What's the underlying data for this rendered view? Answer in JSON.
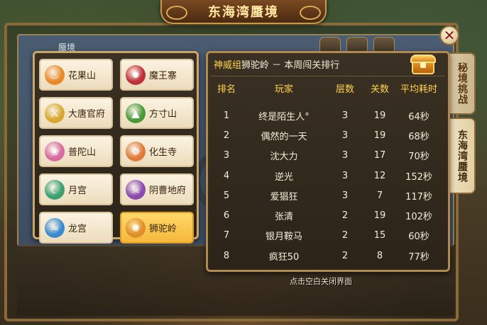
{
  "banner": {
    "title": "东海湾蜃境"
  },
  "panel": {
    "crumb": "蜃境"
  },
  "side_tabs": [
    {
      "label": "秘境挑战"
    },
    {
      "label": "东海湾蜃境"
    }
  ],
  "close": {
    "icon": "close-icon",
    "glyph": "✕"
  },
  "sects": [
    {
      "label": "花果山",
      "icon": "flame-icon",
      "color": "#e8892a",
      "glyph": "♨",
      "selected": false
    },
    {
      "label": "魔王寨",
      "icon": "demon-icon",
      "color": "#c0303a",
      "glyph": "✹",
      "selected": false
    },
    {
      "label": "大唐官府",
      "icon": "sword-icon",
      "color": "#d8a830",
      "glyph": "⚔",
      "selected": false
    },
    {
      "label": "方寸山",
      "icon": "mountain-icon",
      "color": "#4a9a3a",
      "glyph": "▲",
      "selected": false
    },
    {
      "label": "普陀山",
      "icon": "lotus-icon",
      "color": "#d86aa0",
      "glyph": "❀",
      "selected": false
    },
    {
      "label": "化生寺",
      "icon": "temple-icon",
      "color": "#e07a3a",
      "glyph": "☸",
      "selected": false
    },
    {
      "label": "月宫",
      "icon": "moon-icon",
      "color": "#3aa070",
      "glyph": "☾",
      "selected": false
    },
    {
      "label": "阴曹地府",
      "icon": "skull-icon",
      "color": "#8a4ab0",
      "glyph": "☠",
      "selected": false
    },
    {
      "label": "龙宫",
      "icon": "dragon-icon",
      "color": "#3a8ad0",
      "glyph": "≈",
      "selected": false
    },
    {
      "label": "狮驼岭",
      "icon": "lion-icon",
      "color": "#e0902a",
      "glyph": "✺",
      "selected": true
    }
  ],
  "ranking": {
    "group": "神威组",
    "title_rest": "狮驼岭 － 本周闯关排行",
    "chest_icon": "treasure-chest-icon",
    "columns": [
      "排名",
      "玩家",
      "层数",
      "关数",
      "平均耗时"
    ],
    "rows": [
      {
        "rank": "1",
        "player": "终是陌生人°",
        "layers": "3",
        "levels": "19",
        "time": "64秒"
      },
      {
        "rank": "2",
        "player": "偶然的一天",
        "layers": "3",
        "levels": "19",
        "time": "68秒"
      },
      {
        "rank": "3",
        "player": "沈大力",
        "layers": "3",
        "levels": "17",
        "time": "70秒"
      },
      {
        "rank": "4",
        "player": "逆光",
        "layers": "3",
        "levels": "12",
        "time": "152秒"
      },
      {
        "rank": "5",
        "player": "爱猖狂",
        "layers": "3",
        "levels": "7",
        "time": "117秒"
      },
      {
        "rank": "6",
        "player": "张清",
        "layers": "2",
        "levels": "19",
        "time": "102秒"
      },
      {
        "rank": "7",
        "player": "银月鞍马",
        "layers": "2",
        "levels": "15",
        "time": "60秒"
      },
      {
        "rank": "8",
        "player": "疯狂50",
        "layers": "2",
        "levels": "8",
        "time": "77秒"
      }
    ]
  },
  "hint": "点击空白关闭界面"
}
